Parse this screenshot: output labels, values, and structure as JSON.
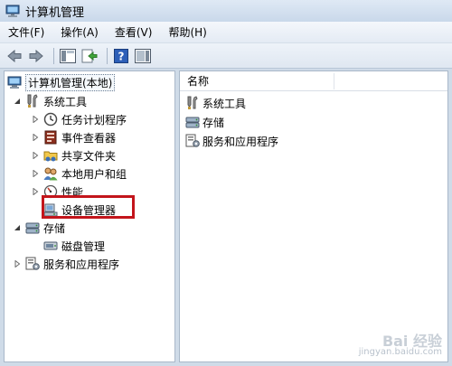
{
  "window": {
    "title": "计算机管理"
  },
  "menu": [
    "文件(F)",
    "操作(A)",
    "查看(V)",
    "帮助(H)"
  ],
  "toolbar": {
    "buttons": [
      "back-arrow-icon",
      "forward-arrow-icon",
      "show-hide-tree-icon",
      "export-list-icon",
      "help-icon",
      "show-hide-action-pane-icon"
    ]
  },
  "tree": {
    "root": "计算机管理(本地)",
    "system_tools": "系统工具",
    "task_scheduler": "任务计划程序",
    "event_viewer": "事件查看器",
    "shared_folders": "共享文件夹",
    "local_users": "本地用户和组",
    "performance": "性能",
    "device_manager": "设备管理器",
    "storage": "存储",
    "disk_management": "磁盘管理",
    "services_apps": "服务和应用程序"
  },
  "list": {
    "column_name": "名称",
    "items": [
      "系统工具",
      "存储",
      "服务和应用程序"
    ]
  },
  "watermark": {
    "main": "Bai 经验",
    "sub": "jingyan.baidu.com"
  },
  "colors": {
    "highlight": "#c3151b",
    "title_bg": "#c9d8ea",
    "pane_border": "#a9b8c9"
  }
}
